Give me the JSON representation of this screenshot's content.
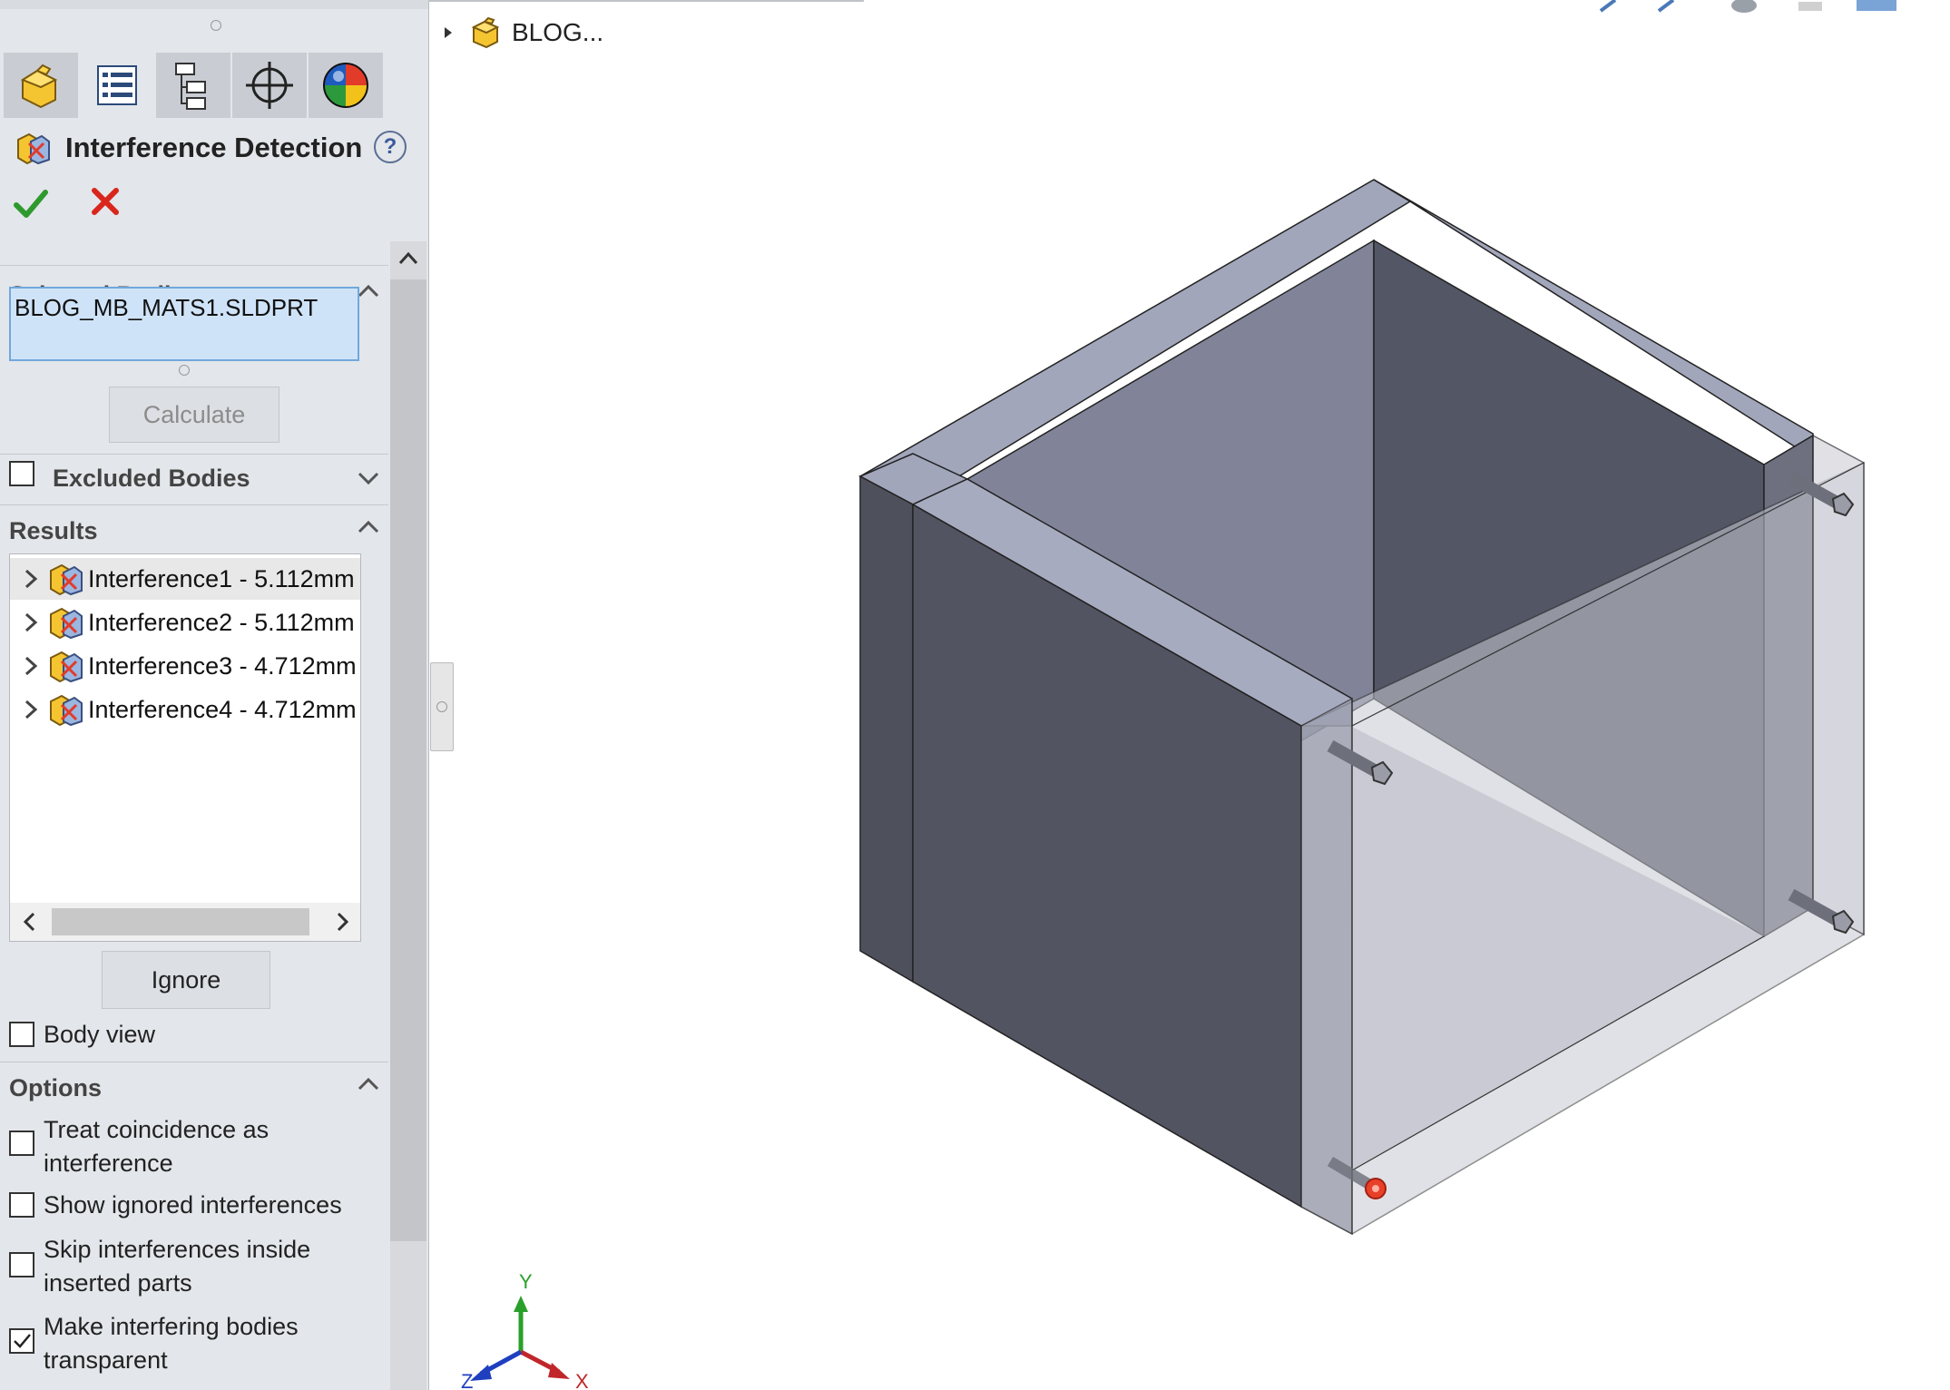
{
  "panel": {
    "title": "Interference Detection",
    "help": "?",
    "selected_bodies": {
      "header": "Selected Bodies",
      "value": "BLOG_MB_MATS1.SLDPRT",
      "calculate_label": "Calculate"
    },
    "excluded_bodies": {
      "header": "Excluded Bodies",
      "checked": false
    },
    "results": {
      "header": "Results",
      "items": [
        {
          "label": "Interference1 - 5.112mm"
        },
        {
          "label": "Interference2 - 5.112mm"
        },
        {
          "label": "Interference3 - 4.712mm"
        },
        {
          "label": "Interference4 - 4.712mm"
        }
      ],
      "ignore_label": "Ignore",
      "body_view_label": "Body view",
      "body_view_checked": false
    },
    "options": {
      "header": "Options",
      "items": [
        {
          "label_line1": "Treat coincidence as",
          "label_line2": "interference",
          "checked": false
        },
        {
          "label_line1": "Show ignored interferences",
          "label_line2": "",
          "checked": false
        },
        {
          "label_line1": "Skip interferences inside",
          "label_line2": "inserted parts",
          "checked": false
        },
        {
          "label_line1": "Make interfering bodies",
          "label_line2": "transparent",
          "checked": true
        }
      ]
    }
  },
  "tree": {
    "root_label": "BLOG..."
  },
  "triad": {
    "y": "Y",
    "x": "X",
    "z": "Z"
  },
  "colors": {
    "accent_ok": "#2e9a2e",
    "accent_cancel": "#d9261c",
    "selection_fill": "#cfe3f8",
    "interference_marker": "#e8402a"
  }
}
